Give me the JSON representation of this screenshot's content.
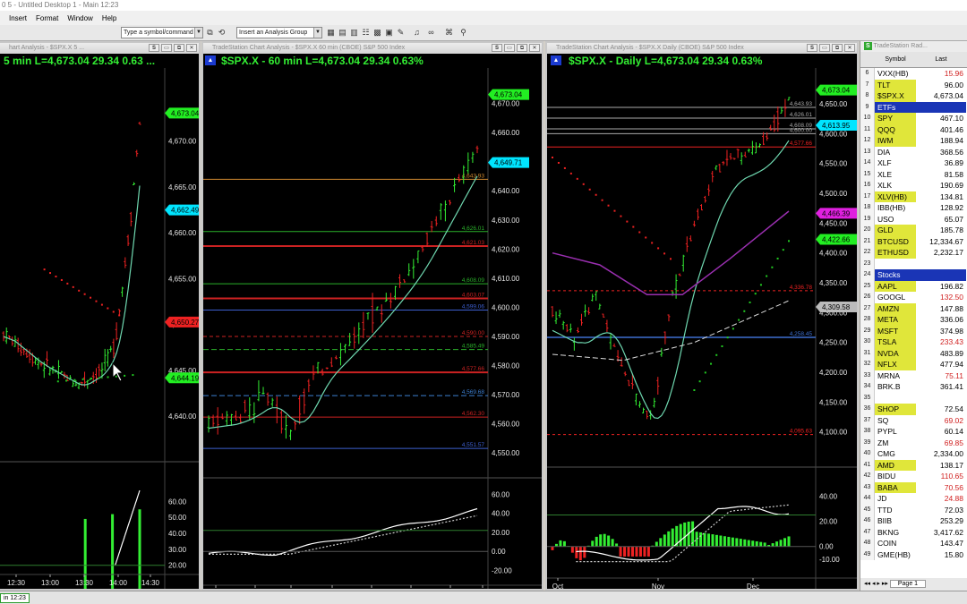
{
  "app": {
    "title": "0 5 - Untitled Desktop 1 - Main 12:23"
  },
  "menu": [
    "Insert",
    "Format",
    "Window",
    "Help"
  ],
  "toolbar": {
    "symbol_placeholder": "Type a symbol/command",
    "analysis_group_placeholder": "Insert an Analysis Group"
  },
  "charts": [
    {
      "window_title": "hart Analysis - $SPX.X 5 ...",
      "title": "5 min  L=4,673.04  29.34  0.63 ...",
      "price_labels": [
        "4,670.00",
        "4,665.00",
        "4,660.00",
        "4,655.00",
        "4,650.00",
        "4,645.00",
        "4,640.00"
      ],
      "price_tags": [
        {
          "text": "4,673.04",
          "kind": "green"
        },
        {
          "text": "4,662.49",
          "kind": "cyan"
        },
        {
          "text": "4,650.27",
          "kind": "red"
        },
        {
          "text": "4,644.19",
          "kind": "green"
        }
      ],
      "osc_labels": [
        "60.00",
        "50.00",
        "40.00",
        "30.00",
        "20.00"
      ],
      "x_labels": [
        "12:30",
        "13:00",
        "13:30",
        "14:00",
        "14:30"
      ]
    },
    {
      "window_title": "TradeStation Chart Analysis - $SPX.X 60 min (CBOE) S&P 500 Index",
      "title": "$SPX.X - 60 min  L=4,673.04  29.34  0.63%",
      "price_labels": [
        "4,670.00",
        "4,660.00",
        "4,650.00",
        "4,640.00",
        "4,630.00",
        "4,620.00",
        "4,610.00",
        "4,600.00",
        "4,590.00",
        "4,580.00",
        "4,570.00",
        "4,560.00",
        "4,550.00"
      ],
      "price_tags": [
        {
          "text": "4,673.04",
          "kind": "green"
        },
        {
          "text": "4,649.71",
          "kind": "cyan"
        }
      ],
      "level_labels": [
        "4,643.93",
        "4,626.01",
        "4,621.03",
        "4,608.09",
        "4,603.07",
        "4,599.06",
        "4,590.00",
        "4,585.49",
        "4,577.66",
        "4,569.68",
        "4,562.30",
        "4,551.57"
      ],
      "osc_labels": [
        "60.00",
        "40.00",
        "20.00",
        "0.00",
        "-20.00"
      ],
      "osc_note": "66.80% (56.45)",
      "x_labels": [
        "12/5",
        "12/6",
        "12/7",
        "12/8",
        "12/11",
        "12/12",
        "12/13",
        "16:00"
      ]
    },
    {
      "window_title": "TradeStation Chart Analysis - $SPX.X Daily (CBOE) S&P 500 Index",
      "title": "$SPX.X - Daily  L=4,673.04  29.34  0.63%",
      "price_labels": [
        "4,650.00",
        "4,600.00",
        "4,550.00",
        "4,500.00",
        "4,450.00",
        "4,400.00",
        "4,350.00",
        "4,300.00",
        "4,250.00",
        "4,200.00",
        "4,150.00",
        "4,100.00"
      ],
      "price_tags": [
        {
          "text": "4,673.04",
          "kind": "green"
        },
        {
          "text": "4,613.95",
          "kind": "cyan"
        },
        {
          "text": "4,466.39",
          "kind": "magenta"
        },
        {
          "text": "4,422.66",
          "kind": "green"
        },
        {
          "text": "4,309.58",
          "kind": "gray"
        }
      ],
      "level_labels": [
        "4,643.93",
        "4,626.01",
        "4,608.09",
        "4,600.00",
        "4,577.66",
        "4,336.78",
        "4,258.45",
        "4,095.63"
      ],
      "osc_labels": [
        "40.00",
        "20.00",
        "0.00",
        "-10.00"
      ],
      "x_labels": [
        "Oct",
        "Nov",
        "Dec"
      ]
    }
  ],
  "watchlist": {
    "window_title": "TradeStation Rad...",
    "columns": [
      "Symbol",
      "Last"
    ],
    "rows": [
      {
        "n": "6",
        "sym": "VXX(HB)",
        "last": "15.96",
        "hl": false,
        "dn": true
      },
      {
        "n": "7",
        "sym": "TLT",
        "last": "96.00",
        "hl": true,
        "dn": false
      },
      {
        "n": "8",
        "sym": "$SPX.X",
        "last": "4,673.04",
        "hl": true,
        "dn": false
      },
      {
        "n": "9",
        "sym": "ETFs",
        "last": "",
        "section": true
      },
      {
        "n": "10",
        "sym": "SPY",
        "last": "467.10",
        "hl": true,
        "dn": false
      },
      {
        "n": "11",
        "sym": "QQQ",
        "last": "401.46",
        "hl": true,
        "dn": false
      },
      {
        "n": "12",
        "sym": "IWM",
        "last": "188.94",
        "hl": true,
        "dn": false
      },
      {
        "n": "13",
        "sym": "DIA",
        "last": "368.56",
        "hl": false,
        "dn": false
      },
      {
        "n": "14",
        "sym": "XLF",
        "last": "36.89",
        "hl": false,
        "dn": false
      },
      {
        "n": "15",
        "sym": "XLE",
        "last": "81.58",
        "hl": false,
        "dn": false
      },
      {
        "n": "16",
        "sym": "XLK",
        "last": "190.69",
        "hl": false,
        "dn": false
      },
      {
        "n": "17",
        "sym": "XLV(HB)",
        "last": "134.81",
        "hl": true,
        "dn": false
      },
      {
        "n": "18",
        "sym": "IBB(HB)",
        "last": "128.92",
        "hl": false,
        "dn": false
      },
      {
        "n": "19",
        "sym": "USO",
        "last": "65.07",
        "hl": false,
        "dn": false
      },
      {
        "n": "20",
        "sym": "GLD",
        "last": "185.78",
        "hl": true,
        "dn": false
      },
      {
        "n": "21",
        "sym": "BTCUSD",
        "last": "12,334.67",
        "hl": true,
        "dn": false
      },
      {
        "n": "22",
        "sym": "ETHUSD",
        "last": "2,232.17",
        "hl": true,
        "dn": false
      },
      {
        "n": "23",
        "sym": "",
        "last": "",
        "hl": false,
        "dn": false
      },
      {
        "n": "24",
        "sym": "Stocks",
        "last": "",
        "section": true
      },
      {
        "n": "25",
        "sym": "AAPL",
        "last": "196.82",
        "hl": true,
        "dn": false
      },
      {
        "n": "26",
        "sym": "GOOGL",
        "last": "132.50",
        "hl": false,
        "dn": true
      },
      {
        "n": "27",
        "sym": "AMZN",
        "last": "147.88",
        "hl": true,
        "dn": false
      },
      {
        "n": "28",
        "sym": "META",
        "last": "336.06",
        "hl": true,
        "dn": false
      },
      {
        "n": "29",
        "sym": "MSFT",
        "last": "374.98",
        "hl": true,
        "dn": false
      },
      {
        "n": "30",
        "sym": "TSLA",
        "last": "233.43",
        "hl": true,
        "dn": true
      },
      {
        "n": "31",
        "sym": "NVDA",
        "last": "483.89",
        "hl": true,
        "dn": false
      },
      {
        "n": "32",
        "sym": "NFLX",
        "last": "477.94",
        "hl": true,
        "dn": false
      },
      {
        "n": "33",
        "sym": "MRNA",
        "last": "75.11",
        "hl": false,
        "dn": true
      },
      {
        "n": "34",
        "sym": "BRK.B",
        "last": "361.41",
        "hl": false,
        "dn": false
      },
      {
        "n": "35",
        "sym": "",
        "last": "",
        "hl": false,
        "dn": false
      },
      {
        "n": "36",
        "sym": "SHOP",
        "last": "72.54",
        "hl": true,
        "dn": false
      },
      {
        "n": "37",
        "sym": "SQ",
        "last": "69.02",
        "hl": false,
        "dn": true
      },
      {
        "n": "38",
        "sym": "PYPL",
        "last": "60.14",
        "hl": false,
        "dn": false
      },
      {
        "n": "39",
        "sym": "ZM",
        "last": "69.85",
        "hl": false,
        "dn": true
      },
      {
        "n": "40",
        "sym": "CMG",
        "last": "2,334.00",
        "hl": false,
        "dn": false
      },
      {
        "n": "41",
        "sym": "AMD",
        "last": "138.17",
        "hl": true,
        "dn": false
      },
      {
        "n": "42",
        "sym": "BIDU",
        "last": "110.65",
        "hl": false,
        "dn": true
      },
      {
        "n": "43",
        "sym": "BABA",
        "last": "70.56",
        "hl": true,
        "dn": true
      },
      {
        "n": "44",
        "sym": "JD",
        "last": "24.88",
        "hl": false,
        "dn": true
      },
      {
        "n": "45",
        "sym": "TTD",
        "last": "72.03",
        "hl": false,
        "dn": false
      },
      {
        "n": "46",
        "sym": "BIIB",
        "last": "253.29",
        "hl": false,
        "dn": false
      },
      {
        "n": "47",
        "sym": "BKNG",
        "last": "3,417.62",
        "hl": false,
        "dn": false
      },
      {
        "n": "48",
        "sym": "COIN",
        "last": "143.47",
        "hl": false,
        "dn": false
      },
      {
        "n": "49",
        "sym": "GME(HB)",
        "last": "15.80",
        "hl": false,
        "dn": false
      }
    ],
    "page_tab": "Page 1"
  },
  "status": {
    "tab": "in 12:23"
  },
  "colors": {
    "up": "#33ee33",
    "down": "#ee2222",
    "cyan": "#00e5ff",
    "highlight": "#e0e63a",
    "section": "#1a35b6"
  }
}
